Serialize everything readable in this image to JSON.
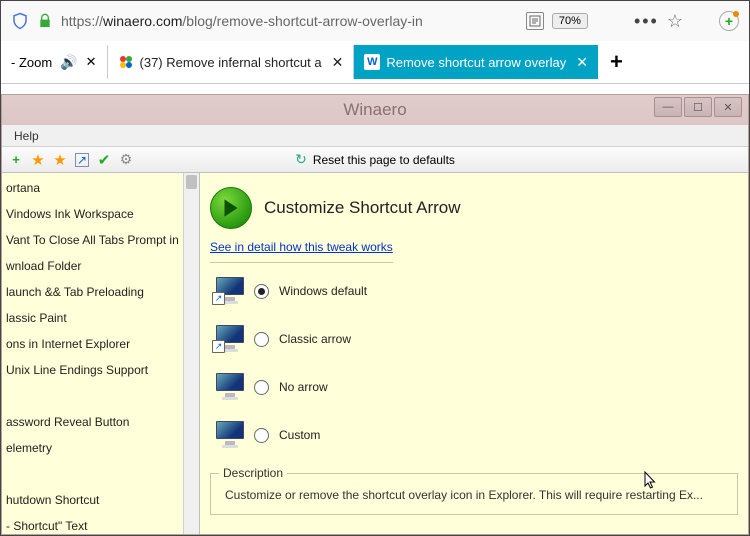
{
  "browser": {
    "url_prefix": "https://",
    "url_host": "winaero.com",
    "url_path": "/blog/remove-shortcut-arrow-overlay-in",
    "zoom_pct": "70%",
    "zoom_label": "- Zoom",
    "tabs": [
      {
        "label": "(37) Remove infernal shortcut a"
      },
      {
        "label": "Remove shortcut arrow overlay"
      }
    ]
  },
  "app": {
    "title": "Winaero",
    "menu": {
      "help": "Help"
    },
    "toolbar_reset": "Reset this page to defaults",
    "sidebar_items": [
      "ortana",
      "Vindows Ink Workspace",
      "Vant To Close All Tabs Prompt in",
      "wnload Folder",
      "launch && Tab Preloading",
      "lassic Paint",
      "ons in Internet Explorer",
      "Unix Line Endings Support",
      "",
      "assword Reveal Button",
      "elemetry",
      "",
      "hutdown Shortcut",
      "- Shortcut\" Text"
    ],
    "main": {
      "title": "Customize Shortcut Arrow",
      "link": "See in detail how this tweak works",
      "options": [
        {
          "label": "Windows default",
          "checked": true,
          "badge": "↗"
        },
        {
          "label": "Classic arrow",
          "checked": false,
          "badge": "↗"
        },
        {
          "label": "No arrow",
          "checked": false,
          "badge": ""
        },
        {
          "label": "Custom",
          "checked": false,
          "badge": ""
        }
      ],
      "desc_legend": "Description",
      "desc_text": "Customize or remove the shortcut overlay icon in Explorer. This will require restarting Ex..."
    }
  }
}
